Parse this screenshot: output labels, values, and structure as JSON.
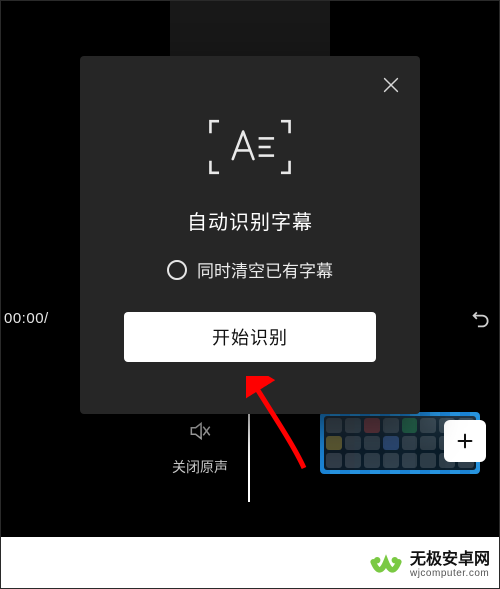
{
  "editor": {
    "time_display": "00:00/",
    "mute_label": "关闭原声"
  },
  "modal": {
    "title": "自动识别字幕",
    "clear_existing_label": "同时清空已有字幕",
    "start_button": "开始识别"
  },
  "watermark": {
    "brand": "无极安卓网",
    "url": "wjcomputer.com"
  },
  "colors": {
    "modal_bg": "#262626",
    "accent_arrow": "#ff0000",
    "wm_green": "#7ac943"
  }
}
